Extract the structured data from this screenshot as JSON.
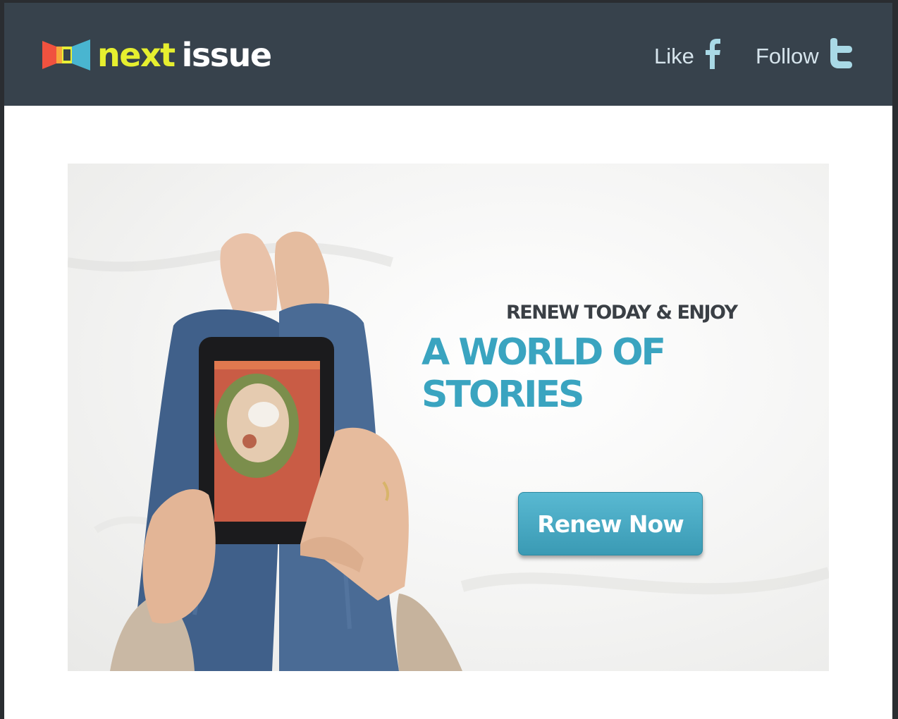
{
  "header": {
    "logo": {
      "word1": "next",
      "word2": "issue"
    },
    "social": [
      {
        "label": "Like",
        "icon": "facebook-icon"
      },
      {
        "label": "Follow",
        "icon": "twitter-icon"
      }
    ]
  },
  "hero": {
    "tagline": "RENEW TODAY & ENJOY",
    "headline": "A WORLD OF STORIES",
    "cta_label": "Renew Now"
  },
  "colors": {
    "header_bg": "#37424c",
    "logo_next": "#e6ef2f",
    "headline": "#3aa4c0",
    "button": "#4aaac4"
  }
}
